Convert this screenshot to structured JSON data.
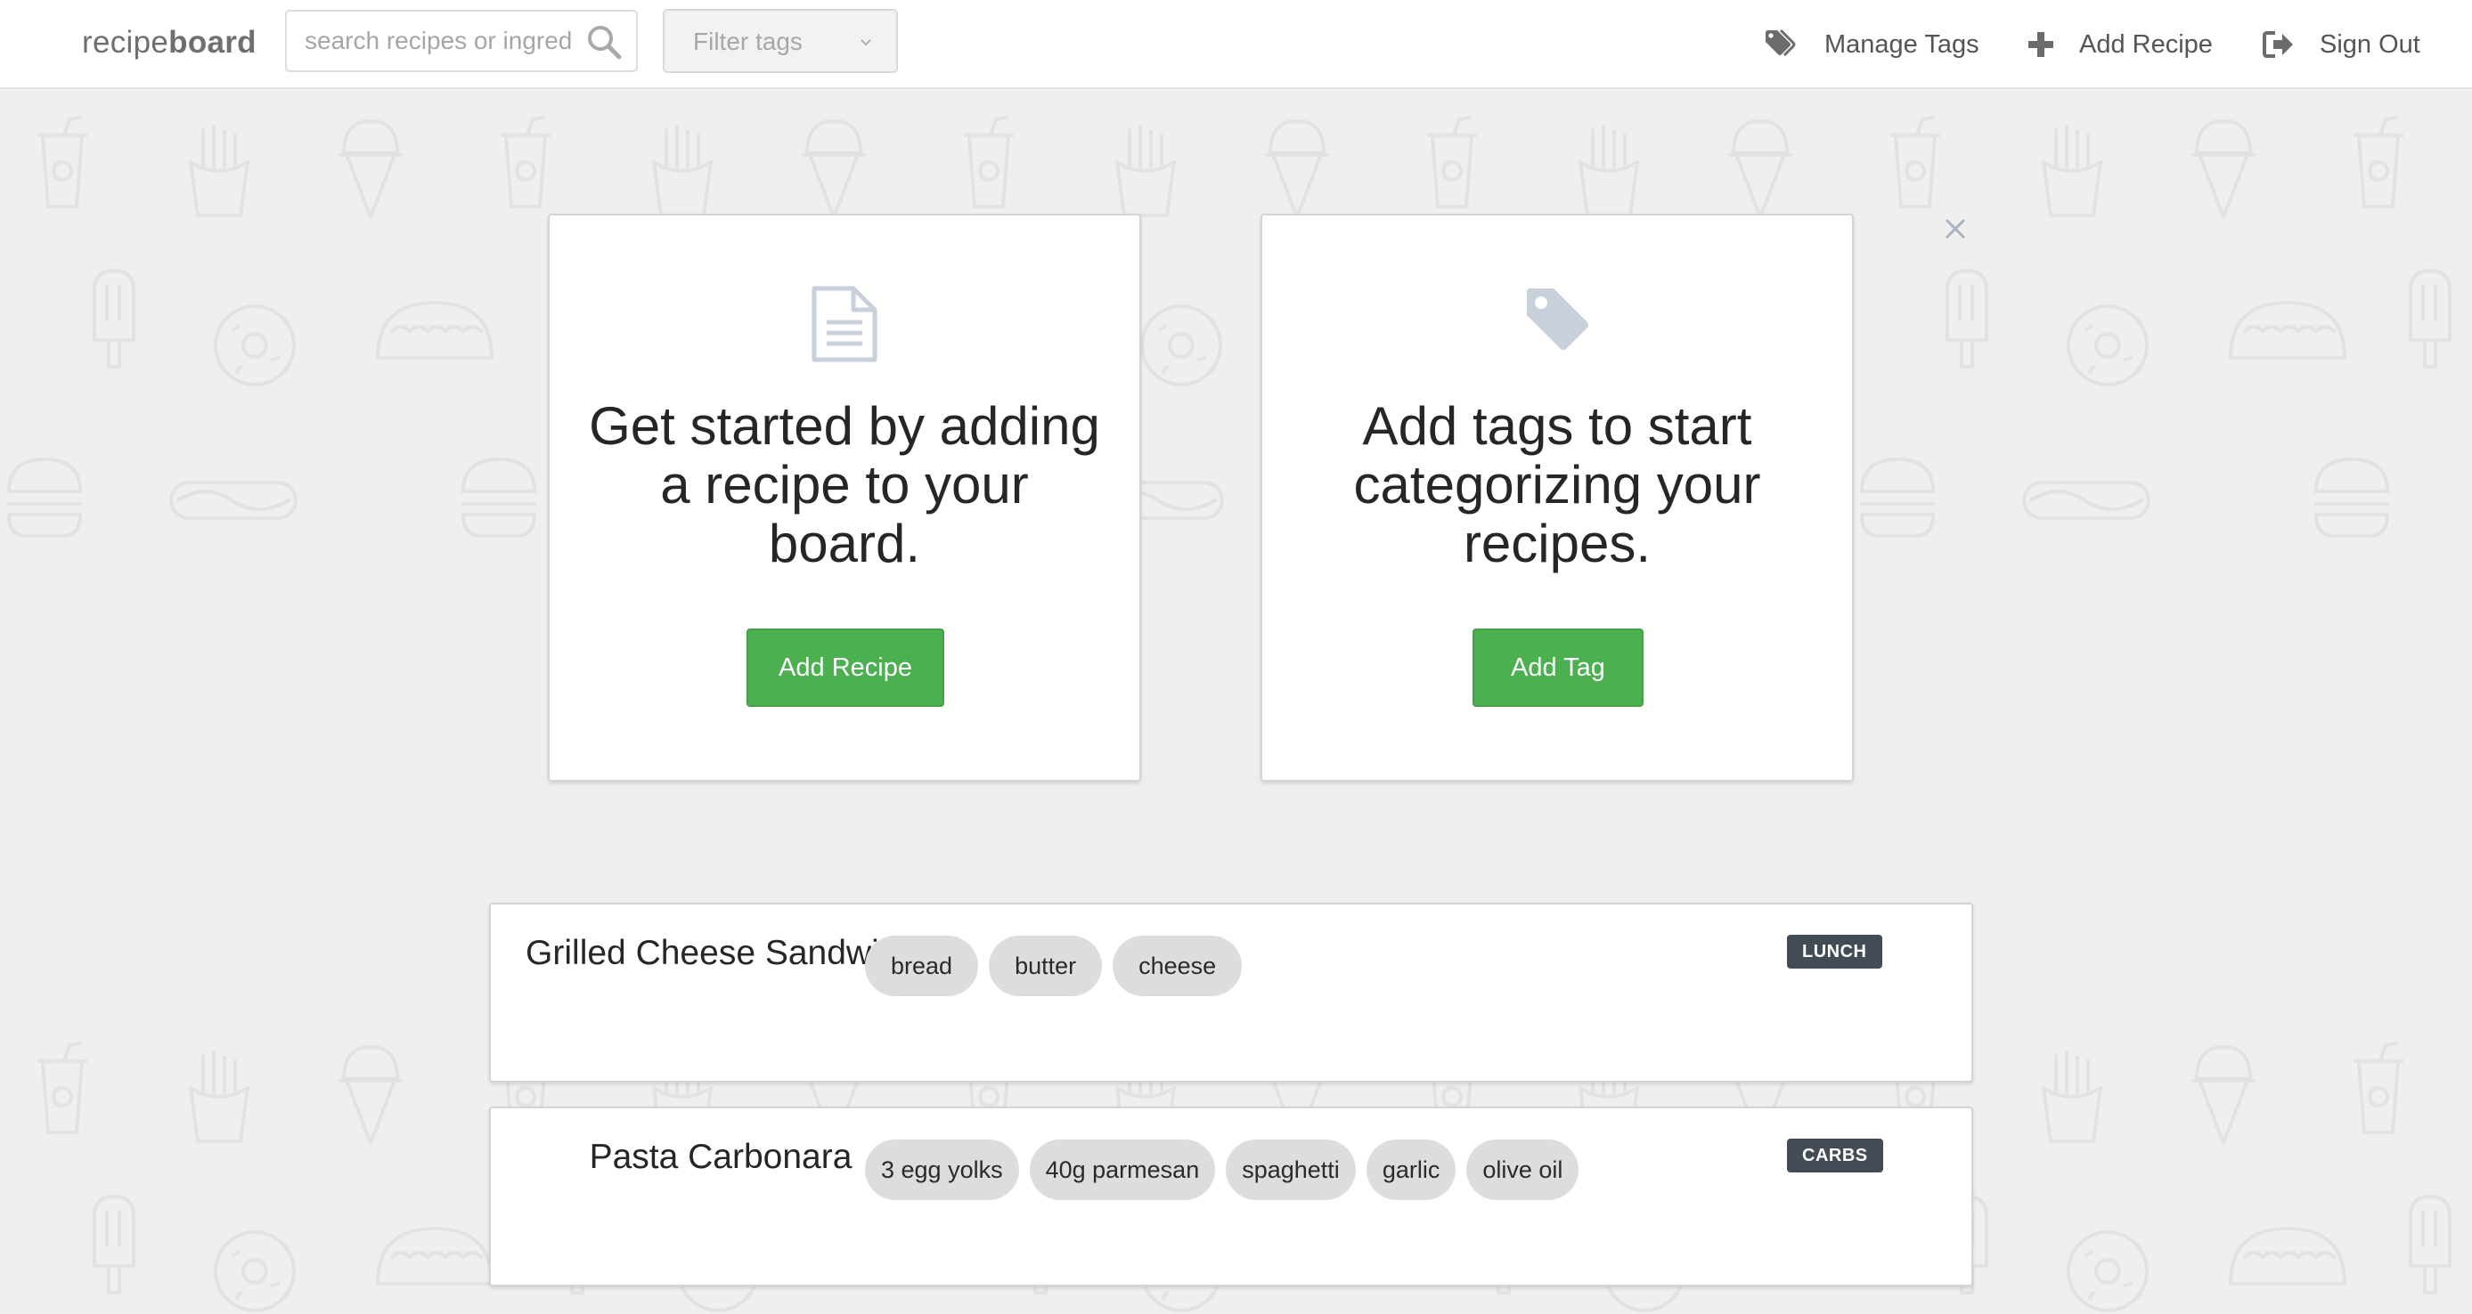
{
  "header": {
    "logo_regular": "recipe",
    "logo_bold": "board",
    "search_placeholder": "search recipes or ingredients",
    "filter_placeholder": "Filter tags",
    "nav": {
      "manage_tags": "Manage Tags",
      "add_recipe": "Add Recipe",
      "sign_out": "Sign Out"
    }
  },
  "onboarding": {
    "recipe_card": {
      "message": "Get started by adding a recipe to your board.",
      "button": "Add Recipe",
      "icon": "document-icon"
    },
    "tag_card": {
      "message": "Add tags to start categorizing your recipes.",
      "button": "Add Tag",
      "icon": "tag-icon"
    },
    "dismiss_icon": "close-icon"
  },
  "recipes": [
    {
      "title": "Grilled Cheese Sandwich",
      "ingredients": [
        "bread",
        "butter",
        "cheese"
      ],
      "tag": "LUNCH"
    },
    {
      "title": "Pasta Carbonara",
      "ingredients": [
        "3 egg yolks",
        "40g parmesan",
        "spaghetti",
        "garlic",
        "olive oil"
      ],
      "tag": "CARBS"
    }
  ],
  "colors": {
    "accent_green": "#4caf50",
    "badge": "#434b55",
    "chip": "#dddddd",
    "background": "#efefef"
  }
}
